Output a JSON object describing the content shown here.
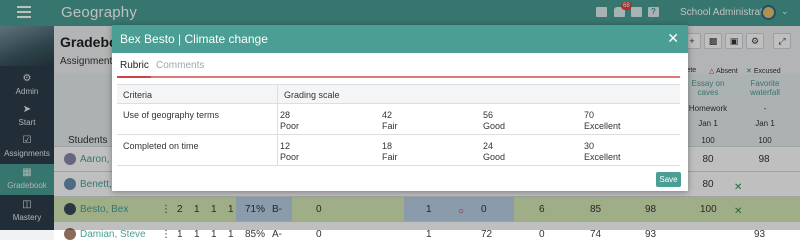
{
  "app": {
    "title": "Geography",
    "notification_count": "68",
    "user_name": "School Administrator"
  },
  "icons": {
    "menu": "hamburger-icon",
    "mail": "mail-icon",
    "bell": "bell-icon",
    "calendar": "calendar-icon",
    "help": "help-icon"
  },
  "colors": {
    "accent": "#4a9e93",
    "sidebar": "#2d3e4a",
    "highlight_row": "#d6e9b6",
    "danger": "#cc2233"
  },
  "sidebar": {
    "items": [
      {
        "label": "Admin",
        "icon": "gear-icon"
      },
      {
        "label": "Start",
        "icon": "send-icon"
      },
      {
        "label": "Assignments",
        "icon": "checkbox-icon"
      },
      {
        "label": "Gradebook",
        "icon": "table-icon"
      },
      {
        "label": "Mastery",
        "icon": "grid-icon"
      }
    ]
  },
  "gradebook": {
    "title": "Gradebook",
    "subtitle": "Assignments",
    "students_label": "Students",
    "legend": {
      "complete": "plete",
      "absent": "Absent",
      "excused": "Excused"
    },
    "headers": {
      "essay": "Essay on caves",
      "fav": "Favorite waterfall",
      "homework": "Homework",
      "dash": "-",
      "date1": "Jan 1",
      "date2": "Jan 1",
      "max1": "100",
      "max2": "100"
    },
    "rows": [
      {
        "name": "Aaron, Bill",
        "c1": "80",
        "c2": "98"
      },
      {
        "name": "Benett, Tom",
        "c1": "80",
        "c2": ""
      },
      {
        "name": "Besto, Bex",
        "n1": "2",
        "n2": "1",
        "n3": "1",
        "n4": "1",
        "pct": "71%",
        "grade": "B-",
        "g1": "0",
        "g2": "1",
        "g3": "0",
        "g4": "6",
        "g5": "85",
        "g6": "98",
        "g7": "100"
      },
      {
        "name": "Damian, Steve",
        "n1": "1",
        "n2": "1",
        "n3": "1",
        "n4": "1",
        "pct": "85%",
        "grade": "A-",
        "g1": "0",
        "g2": "1",
        "g3": "72",
        "g4": "0",
        "g5": "74",
        "g6": "93",
        "g7": "93"
      }
    ]
  },
  "modal": {
    "title": "Bex Besto | Climate change",
    "tabs": [
      {
        "label": "Rubric"
      },
      {
        "label": "Comments"
      }
    ],
    "rubric": {
      "criteria_header": "Criteria",
      "scale_header": "Grading scale",
      "rows": [
        {
          "criteria": "Use of geography terms",
          "levels": [
            {
              "points": "28",
              "label": "Poor"
            },
            {
              "points": "42",
              "label": "Fair"
            },
            {
              "points": "56",
              "label": "Good"
            },
            {
              "points": "70",
              "label": "Excellent"
            }
          ]
        },
        {
          "criteria": "Completed on time",
          "levels": [
            {
              "points": "12",
              "label": "Poor"
            },
            {
              "points": "18",
              "label": "Fair"
            },
            {
              "points": "24",
              "label": "Good"
            },
            {
              "points": "30",
              "label": "Excellent"
            }
          ]
        }
      ]
    },
    "save_label": "Save"
  }
}
